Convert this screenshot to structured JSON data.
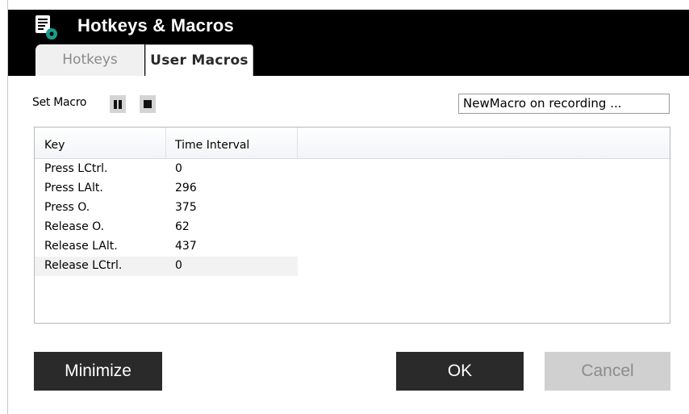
{
  "window": {
    "title": "Hotkeys & Macros",
    "icon": "script-doc-gear-icon"
  },
  "tabs": [
    {
      "label": "Hotkeys",
      "active": false
    },
    {
      "label": "User Macros",
      "active": true
    }
  ],
  "macro": {
    "set_label": "Set Macro",
    "pause_icon": "pause-icon",
    "stop_icon": "stop-icon",
    "status_value": "NewMacro on recording ..."
  },
  "table": {
    "columns": [
      "Key",
      "Time Interval"
    ],
    "rows": [
      {
        "key": "Press LCtrl.",
        "interval": "0"
      },
      {
        "key": "Press LAlt.",
        "interval": "296"
      },
      {
        "key": "Press O.",
        "interval": "375"
      },
      {
        "key": "Release O.",
        "interval": "62"
      },
      {
        "key": "Release LAlt.",
        "interval": "437"
      },
      {
        "key": "Release LCtrl.",
        "interval": "0"
      }
    ]
  },
  "buttons": {
    "minimize": "Minimize",
    "ok": "OK",
    "cancel": "Cancel"
  },
  "colors": {
    "titlebar": "#000000",
    "primary_button": "#2a2a2a",
    "disabled_button": "#d0d0d0",
    "icon_accent": "#1a9c8c"
  }
}
